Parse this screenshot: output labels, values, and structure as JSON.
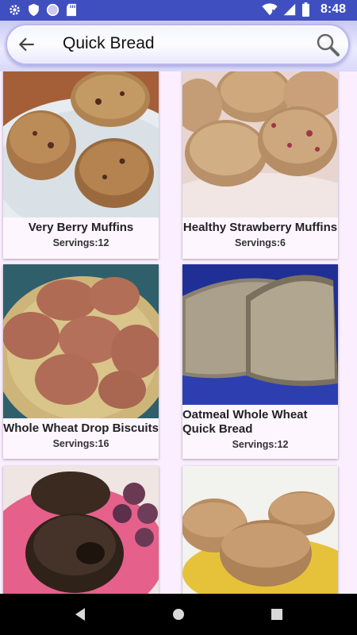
{
  "status_bar": {
    "time": "8:48"
  },
  "app_bar": {
    "title": "Quick Bread"
  },
  "recipes": [
    {
      "name": "Very Berry Muffins",
      "servings": "Servings:12"
    },
    {
      "name": "Healthy Strawberry Muffins",
      "servings": "Servings:6"
    },
    {
      "name": "Whole Wheat Drop Biscuits",
      "servings": "Servings:16"
    },
    {
      "name": "Oatmeal Whole Wheat Quick Bread",
      "servings": "Servings:12"
    },
    {
      "name": "",
      "servings": ""
    },
    {
      "name": "",
      "servings": ""
    }
  ],
  "colors": {
    "status_bar": "#3f4fbf",
    "background": "#fbefff",
    "nav_bar": "#000000"
  }
}
